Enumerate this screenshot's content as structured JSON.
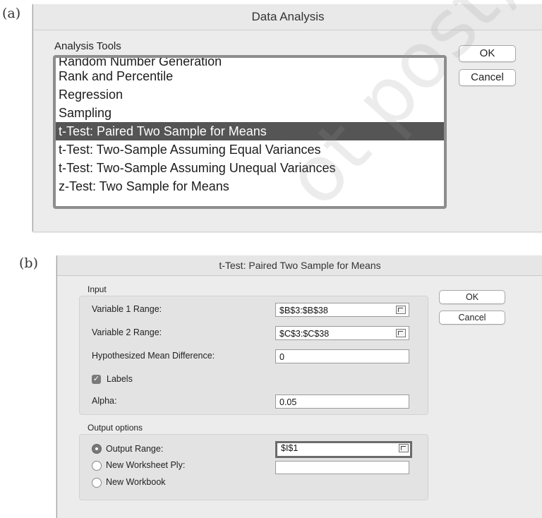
{
  "panel_a": {
    "label": "(a)",
    "title": "Data Analysis",
    "section_label": "Analysis Tools",
    "items": [
      "Random Number Generation",
      "Rank and Percentile",
      "Regression",
      "Sampling",
      "t-Test: Paired Two Sample for Means",
      "t-Test: Two-Sample Assuming Equal Variances",
      "t-Test: Two-Sample Assuming Unequal Variances",
      "z-Test: Two Sample for Means"
    ],
    "selected_item": "t-Test: Paired Two Sample for Means",
    "ok_label": "OK",
    "cancel_label": "Cancel"
  },
  "panel_b": {
    "label": "(b)",
    "title": "t-Test: Paired Two Sample for Means",
    "input_label": "Input",
    "var1_label": "Variable 1 Range:",
    "var1_value": "$B$3:$B$38",
    "var2_label": "Variable 2 Range:",
    "var2_value": "$C$3:$C$38",
    "hyp_label": "Hypothesized Mean Difference:",
    "hyp_value": "0",
    "labels_label": "Labels",
    "labels_checked": true,
    "alpha_label": "Alpha:",
    "alpha_value": "0.05",
    "output_options_label": "Output options",
    "output_range_label": "Output Range:",
    "output_range_value": "$I$1",
    "new_ws_label": "New Worksheet Ply:",
    "new_wb_label": "New Workbook",
    "selected_output": "Output Range",
    "ok_label": "OK",
    "cancel_label": "Cancel"
  },
  "watermark": "ot post, or d",
  "colors": {
    "selection": "#555555",
    "dialog_bg": "#ececec",
    "group_bg": "#e3e3e3"
  }
}
